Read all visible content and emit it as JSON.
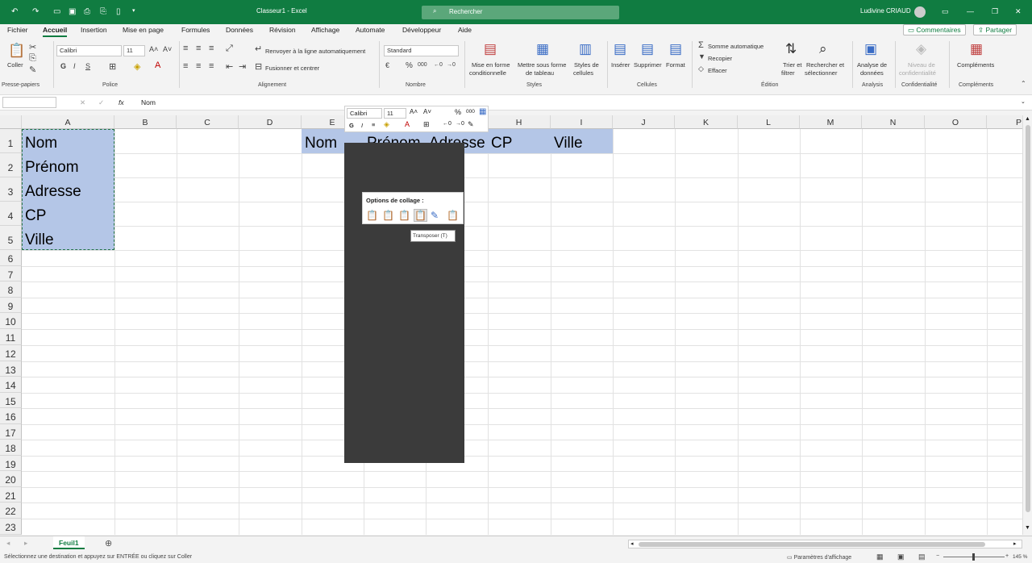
{
  "titlebar": {
    "doc_title": "Classeur1 - Excel",
    "search_placeholder": "Rechercher",
    "user": "Ludivine CRIAUD"
  },
  "menu": {
    "tabs": [
      "Fichier",
      "Accueil",
      "Insertion",
      "Mise en page",
      "Formules",
      "Données",
      "Révision",
      "Affichage",
      "Automate",
      "Développeur",
      "Aide"
    ],
    "comments": "Commentaires",
    "share": "Partager"
  },
  "ribbon": {
    "paste": "Coller",
    "clipboard_group": "Presse-papiers",
    "font_name": "Calibri",
    "font_size": "11",
    "font_group": "Police",
    "wrap_text": "Renvoyer à la ligne automatiquement",
    "merge_center": "Fusionner et centrer",
    "alignment_group": "Alignement",
    "number_format": "Standard",
    "number_group": "Nombre",
    "cond_format_l1": "Mise en forme",
    "cond_format_l2": "conditionnelle",
    "table_format_l1": "Mettre sous forme",
    "table_format_l2": "de tableau",
    "cell_styles_l1": "Styles de",
    "cell_styles_l2": "cellules",
    "styles_group": "Styles",
    "insert": "Insérer",
    "delete": "Supprimer",
    "format": "Format",
    "cells_group": "Cellules",
    "autosum": "Somme automatique",
    "fill": "Recopier",
    "clear": "Effacer",
    "sort_l1": "Trier et",
    "sort_l2": "filtrer",
    "find_l1": "Rechercher et",
    "find_l2": "sélectionner",
    "editing_group": "Édition",
    "analyze_l1": "Analyse de",
    "analyze_l2": "données",
    "analysis_group": "Analysis",
    "sensitivity_l1": "Niveau de",
    "sensitivity_l2": "confidentialité",
    "sensitivity_group": "Confidentialité",
    "addins": "Compléments",
    "addins_group": "Compléments"
  },
  "formula_bar": {
    "fx": "fx",
    "value": "Nom"
  },
  "columns": [
    "A",
    "B",
    "C",
    "D",
    "E",
    "F",
    "G",
    "H",
    "I",
    "J",
    "K",
    "L",
    "M",
    "N",
    "O",
    "P"
  ],
  "rows": [
    "1",
    "2",
    "3",
    "4",
    "5",
    "6",
    "7",
    "8",
    "9",
    "10",
    "11",
    "12",
    "13",
    "14",
    "15",
    "16",
    "17",
    "18",
    "19",
    "20",
    "21",
    "22",
    "23"
  ],
  "cells_colA": [
    "Nom",
    "Prénom",
    "Adresse",
    "CP",
    "Ville"
  ],
  "cells_row1": {
    "e": "Nom",
    "f": "Prénom",
    "g": "Adresse",
    "h": "CP",
    "i": "Ville"
  },
  "mini_toolbar": {
    "font": "Calibri",
    "size": "11",
    "bold": "G",
    "italic": "I"
  },
  "paste_options": {
    "title": "Options de collage :",
    "tooltip": "Transposer (T)"
  },
  "sheets": {
    "tab": "Feuil1"
  },
  "status": {
    "message": "Sélectionnez une destination et appuyez sur ENTRÉE ou cliquez sur Coller",
    "display_settings": "Paramètres d'affichage",
    "zoom": "145 %"
  }
}
